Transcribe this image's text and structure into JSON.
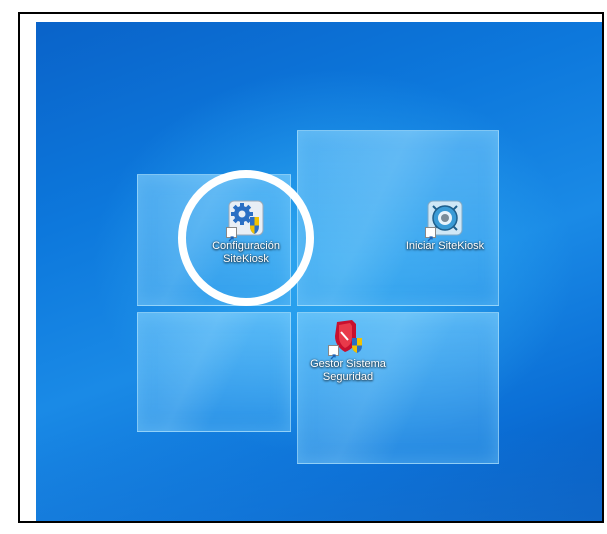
{
  "desktop": {
    "icons": [
      {
        "label": "Configuración\nSiteKiosk",
        "icon": "gear-shield-icon"
      },
      {
        "label": "Iniciar SiteKiosk",
        "icon": "sitekiosk-globe-icon"
      },
      {
        "label": "Gestor Sistema\nSeguridad",
        "icon": "security-shield-icon"
      }
    ]
  },
  "colors": {
    "wallpaper_primary": "#0d78dc",
    "wallpaper_glow": "#2ea8f0",
    "highlight_ring": "#ffffff",
    "frame_border": "#000000"
  }
}
